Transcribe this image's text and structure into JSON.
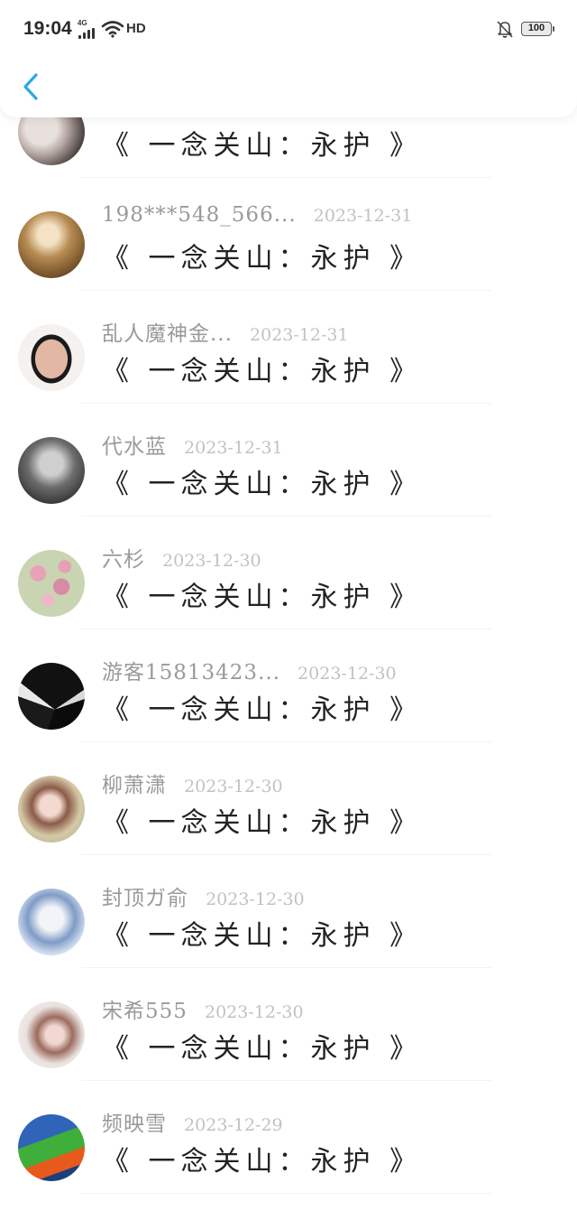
{
  "status_bar": {
    "time": "19:04",
    "network": "4G",
    "hd": "HD",
    "battery": "100"
  },
  "nav": {
    "back_icon": "chevron-left-icon",
    "accent_color": "#2ea8e6"
  },
  "comments": [
    {
      "name": "",
      "date": "",
      "text": "《 一念关山：永护 》",
      "avatar": "avatar-photo-1"
    },
    {
      "name": "198***548_566...",
      "date": "2023-12-31",
      "text": "《 一念关山：永护 》",
      "avatar": "avatar-photo-2"
    },
    {
      "name": "乱人魔神金...",
      "date": "2023-12-31",
      "text": "《 一念关山：永护 》",
      "avatar": "avatar-photo-3"
    },
    {
      "name": "代水蓝",
      "date": "2023-12-31",
      "text": "《 一念关山：永护 》",
      "avatar": "avatar-photo-4"
    },
    {
      "name": "六杉",
      "date": "2023-12-30",
      "text": "《 一念关山：永护 》",
      "avatar": "avatar-photo-5"
    },
    {
      "name": "游客15813423...",
      "date": "2023-12-30",
      "text": "《 一念关山：永护 》",
      "avatar": "avatar-photo-6"
    },
    {
      "name": "柳萧潇",
      "date": "2023-12-30",
      "text": "《 一念关山：永护 》",
      "avatar": "avatar-photo-7"
    },
    {
      "name": "封顶ガ俞",
      "date": "2023-12-30",
      "text": "《 一念关山：永护 》",
      "avatar": "avatar-photo-8"
    },
    {
      "name": "宋希555",
      "date": "2023-12-30",
      "text": "《 一念关山：永护 》",
      "avatar": "avatar-photo-9"
    },
    {
      "name": "频映雪",
      "date": "2023-12-29",
      "text": "《 一念关山：永护 》",
      "avatar": "avatar-photo-10"
    }
  ]
}
